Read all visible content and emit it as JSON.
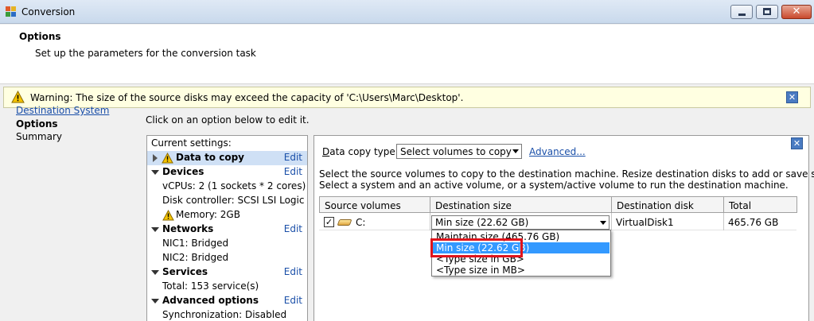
{
  "window": {
    "title": "Conversion"
  },
  "header": {
    "title": "Options",
    "subtitle": "Set up the parameters for the conversion task"
  },
  "warning": {
    "text": "Warning: The size of the source disks may exceed the capacity of 'C:\\Users\\Marc\\Desktop'.",
    "close": "✕"
  },
  "nav": {
    "items": [
      "Destination System",
      "Options",
      "Summary"
    ]
  },
  "instruction": "Click on an option below to edit it.",
  "settings": {
    "title": "Current settings:",
    "edit_label": "Edit",
    "data_to_copy": "Data to copy",
    "devices": "Devices",
    "vcpus": "vCPUs: 2 (1 sockets * 2 cores)",
    "disk_controller": "Disk controller: SCSI LSI Logic ...",
    "memory": "Memory: 2GB",
    "networks": "Networks",
    "nic1": "NIC1: Bridged",
    "nic2": "NIC2: Bridged",
    "services": "Services",
    "services_total": "Total: 153 service(s)",
    "advanced": "Advanced options",
    "sync": "Synchronization: Disabled"
  },
  "detail": {
    "close": "✕",
    "data_copy_type_label_pre": "D",
    "data_copy_type_label_post": "ata copy type:",
    "data_copy_type_value": "Select volumes to copy",
    "advanced_link": "Advanced...",
    "desc_line1": "Select the source volumes to copy to the destination machine. Resize destination disks to add or save space.",
    "desc_line2": "Select a system and an active volume, or a system/active volume to run the destination machine.",
    "columns": [
      "Source volumes",
      "Destination size",
      "Destination disk",
      "Total"
    ],
    "row": {
      "checked": "✓",
      "volume": "C:",
      "size": "Min size (22.62 GB)",
      "disk": "VirtualDisk1",
      "total": "465.76 GB"
    },
    "size_options": [
      "Maintain size (465.76 GB)",
      "Min size (22.62 GB)",
      "<Type size in GB>",
      "<Type size in MB>"
    ],
    "selected_option_index": 1
  },
  "colors": {
    "link": "#1a4fa8",
    "selection": "#3399ff",
    "highlight_box": "#e0141c",
    "warning_bg": "#ffffe1"
  }
}
